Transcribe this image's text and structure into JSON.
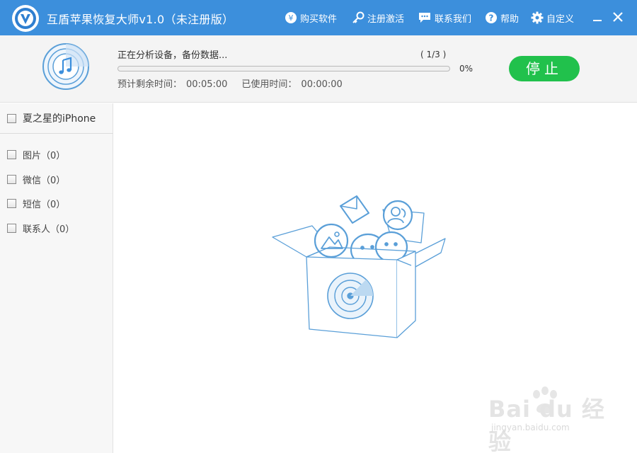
{
  "window": {
    "title": "互盾苹果恢复大师v1.0（未注册版）",
    "accent_color": "#3c8fdc"
  },
  "toolbar": {
    "buy": {
      "label": "购买软件",
      "icon": "yen-coin-icon"
    },
    "register": {
      "label": "注册激活",
      "icon": "key-icon"
    },
    "contact": {
      "label": "联系我们",
      "icon": "chat-bubble-icon"
    },
    "help": {
      "label": "帮助",
      "icon": "question-icon"
    },
    "custom": {
      "label": "自定义",
      "icon": "gear-icon"
    },
    "minimize_icon": "minimize-icon",
    "close_icon": "close-icon"
  },
  "progress": {
    "status": "正在分析设备，备份数据...",
    "step": "( 1/3 )",
    "percent_label": "0%",
    "percent_value": 0,
    "remaining_label": "预计剩余时间：",
    "remaining_value": "00:05:00",
    "elapsed_label": "已使用时间：",
    "elapsed_value": "00:00:00",
    "stop_label": "停止",
    "stop_color": "#21c14c",
    "device_icon": "itunes-radar-icon"
  },
  "sidebar": {
    "device": "夏之星的iPhone",
    "categories": [
      {
        "label": "图片（0）"
      },
      {
        "label": "微信（0）"
      },
      {
        "label": "短信（0）"
      },
      {
        "label": "联系人（0）"
      }
    ]
  },
  "main": {
    "illustration": "open-box-scan-illustration"
  },
  "watermark": {
    "brand": "Bai du 经验",
    "url": "jingyan.baidu.com"
  }
}
